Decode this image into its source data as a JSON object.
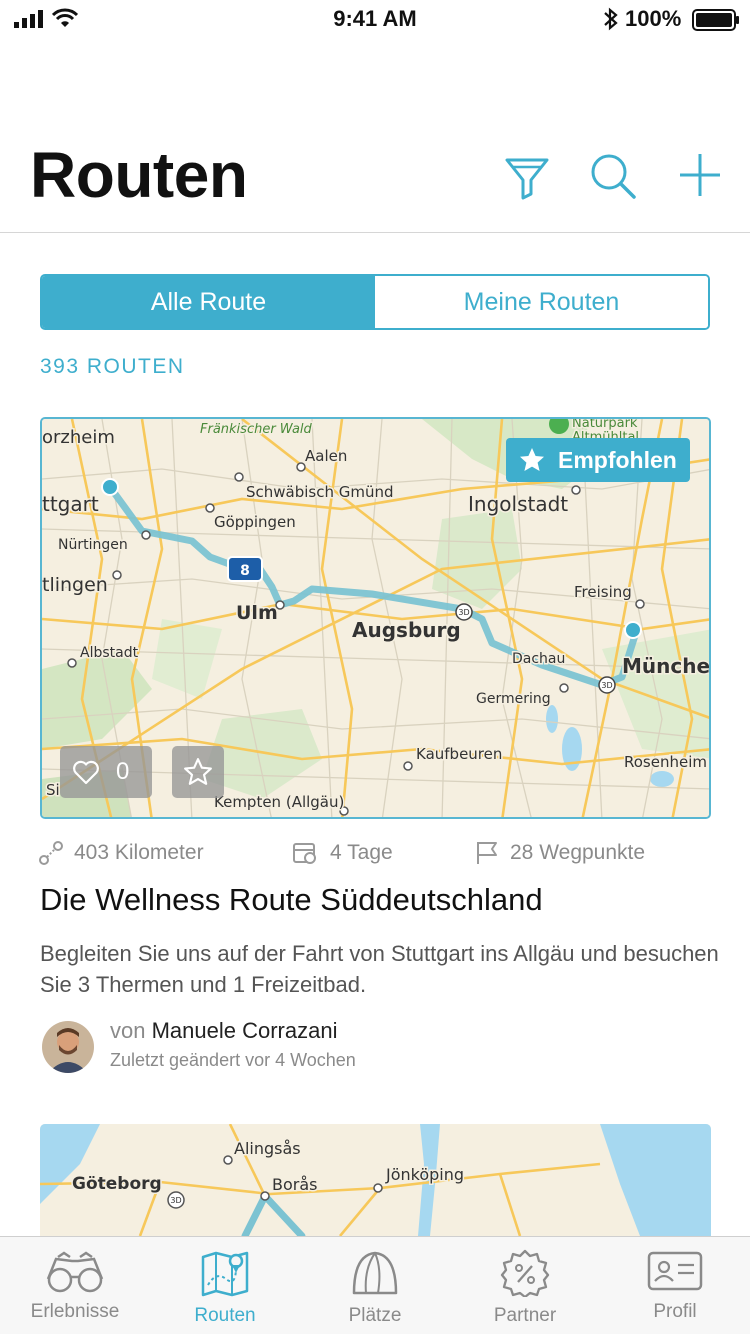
{
  "status_bar": {
    "time": "9:41 AM",
    "battery": "100%"
  },
  "header": {
    "title": "Routen",
    "icons": [
      "filter-icon",
      "search-icon",
      "add-icon"
    ]
  },
  "segments": {
    "all": "Alle Route",
    "mine": "Meine Routen"
  },
  "route_count": "393 ROUTEN",
  "route": {
    "badge": "Empfohlen",
    "likes": "0",
    "distance": "403 Kilometer",
    "duration": "4 Tage",
    "waypoints": "28 Wegpunkte",
    "title": "Die Wellness Route Süddeutschland",
    "description": "Begleiten Sie uns auf der Fahrt von Stuttgart ins Allgäu und besuchen Sie 3 Thermen und 1 Freizeitbad.",
    "author_prefix": "von",
    "author": "Manuele Corrazani",
    "changed": "Zuletzt geändert vor 4 Wochen",
    "map_labels": {
      "pforzheim": "orzheim",
      "frankischer_wald": "Fränkischer Wald",
      "aalen": "Aalen",
      "naturpark_1": "Naturpark",
      "naturpark_2": "Altmühltal",
      "stuttgart": "ttgart",
      "schwabisch_gmund": "Schwäbisch Gmünd",
      "ingolstadt": "Ingolstadt",
      "goppingen": "Göppingen",
      "nurtingen": "Nürtingen",
      "reutlingen": "tlingen",
      "autobahn": "8",
      "freising": "Freising",
      "ulm": "Ulm",
      "augsburg": "Augsburg",
      "albstadt": "Albstadt",
      "dachau": "Dachau",
      "munchen": "Münchel",
      "germering": "Germering",
      "kaufbeuren": "Kaufbeuren",
      "rosenheim": "Rosenheim",
      "kempten": "Kempten (Allgäu)",
      "sigmaringen": "Si",
      "road_3d": "3D"
    }
  },
  "next_map_labels": {
    "alingsas": "Alingsås",
    "goteborg": "Göteborg",
    "boras": "Borås",
    "jonkoping": "Jönköping",
    "road_3d": "3D"
  },
  "tabs": [
    {
      "label": "Erlebnisse",
      "icon": "binoculars-icon"
    },
    {
      "label": "Routen",
      "icon": "map-icon"
    },
    {
      "label": "Plätze",
      "icon": "tent-icon"
    },
    {
      "label": "Partner",
      "icon": "discount-badge-icon"
    },
    {
      "label": "Profil",
      "icon": "profile-card-icon"
    }
  ],
  "colors": {
    "accent": "#3EAECD",
    "route_line": "#7CC3D2",
    "map_bg": "#F5EFE0",
    "road": "#F7C85A",
    "water": "#A6D8F0"
  }
}
